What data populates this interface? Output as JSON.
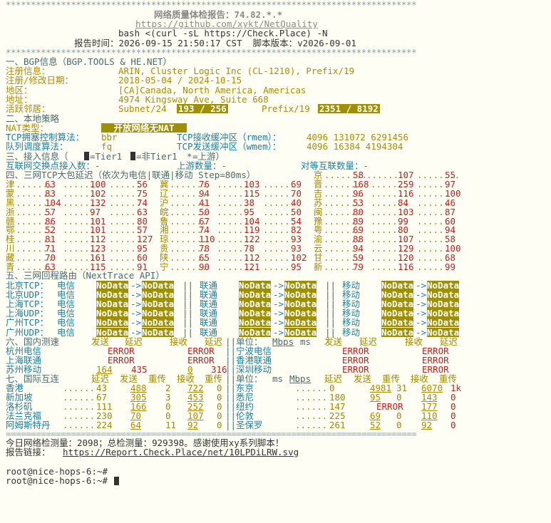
{
  "report": {
    "top_border": "**********************************************************************************",
    "title": "网络质量体检报告：74.82.*.*",
    "url": "https://github.com/xykt/NetQuality",
    "command": "bash <(curl -sL https://Check.Place) -N",
    "time_line": "报告时间：2026-09-15 21:50:17 CST  脚本版本：v2026-09-01",
    "divider": "**********************************************************************************"
  },
  "bgp": {
    "heading": "一、BGP信息（BGP.TOOLS & HE.NET）",
    "rows": [
      {
        "label": "注册信息：",
        "value": "ARIN, Cluster Logic Inc (CL-1210), Prefix/19"
      },
      {
        "label": "注册/修改日期：",
        "value": "2018-05-04 / 2024-10-15"
      },
      {
        "label": "地区：",
        "value": "[CA]Canada, North America, Americas"
      },
      {
        "label": "地址：",
        "value": "4974 Kingsway Ave, Suite 668"
      }
    ],
    "active_label": "活跃邻居：",
    "subnet_label": "Subnet/24",
    "subnet_value": "193 / 256",
    "prefix_label": "Prefix/19",
    "prefix_value": "2351 / 8192"
  },
  "local": {
    "heading": "二、本地策略",
    "nat_label": "NAT类型：",
    "nat_value": "开放网络无NAT",
    "cc_label": "TCP拥塞控制算法：",
    "cc_value": "bbr",
    "rmem_label": "TCP接收缓冲区（rmem）：",
    "rmem_value": "4096 131072 6291456",
    "qd_label": "队列调度算法：",
    "qd_value": "fq",
    "wmem_label": "TCP发送缓冲区（wmem）：",
    "wmem_value": "4096 16384 4194304"
  },
  "access": {
    "heading": "三、接入信息（",
    "legend_a": "=Tier1 ",
    "legend_b": "=非Tier1 ",
    "legend_star": "*",
    "legend_c": "=上游）",
    "ix_label": "互联网交换点接入数：-",
    "up_label": "上游数量：-",
    "peer_label": "对等互联数量：-"
  },
  "tcp": {
    "heading": "四、三网TCP大包延迟（依次为电信|联通|移动 Step=80ms）",
    "rows": [
      {
        "p1": "京",
        "a1": "58",
        "b1": "107",
        "c1": "55"
      },
      {
        "p0": "津",
        "a0": "63",
        "b0": "100",
        "c0": "56",
        "p1": "冀",
        "a1": "76",
        "b1": "103",
        "c1": "69",
        "p2": "晋",
        "a2": "168",
        "b2": "259",
        "c2": "97"
      },
      {
        "p0": "蒙",
        "a0": "83",
        "b0": "102",
        "c0": "75",
        "p1": "辽",
        "a1": "94",
        "b1": "115",
        "c1": "70",
        "p2": "吉",
        "a2": "96",
        "b2": "116",
        "c2": "100"
      },
      {
        "p0": "黑",
        "a0": "104",
        "b0": "132",
        "c0": "74",
        "p1": "沪",
        "a1": "41",
        "b1": "38",
        "c1": "40",
        "p2": "苏",
        "a2": "53",
        "b2": "84",
        "c2": "46"
      },
      {
        "p0": "浙",
        "a0": "57",
        "b0": "97",
        "c0": "63",
        "p1": "皖",
        "a1": "50",
        "b1": "95",
        "c1": "50",
        "p2": "闽",
        "a2": "80",
        "b2": "103",
        "c2": "87"
      },
      {
        "p0": "赣",
        "a0": "86",
        "b0": "101",
        "c0": "80",
        "p1": "鲁",
        "a1": "67",
        "b1": "104",
        "c1": "54",
        "p2": "豫",
        "a2": "89",
        "b2": "99",
        "c2": "60"
      },
      {
        "p0": "鄂",
        "a0": "52",
        "b0": "101",
        "c0": "57",
        "p1": "湘",
        "a1": "74",
        "b1": "119",
        "c1": "82",
        "p2": "粤",
        "a2": "69",
        "b2": "80",
        "c2": "94"
      },
      {
        "p0": "桂",
        "a0": "81",
        "b0": "112",
        "c0": "127",
        "p1": "琼",
        "a1": "110",
        "b1": "122",
        "c1": "93",
        "p2": "渝",
        "a2": "88",
        "b2": "107",
        "c2": "58"
      },
      {
        "p0": "川",
        "a0": "71",
        "b0": "123",
        "c0": "95",
        "p1": "贵",
        "a1": "78",
        "b1": "78",
        "c1": "93",
        "p2": "云",
        "a2": "94",
        "b2": "129",
        "c2": "100"
      },
      {
        "p0": "藏",
        "a0": "70",
        "b0": "161",
        "c0": "60",
        "p1": "陕",
        "a1": "65",
        "b1": "112",
        "c1": "102",
        "p2": "甘",
        "a2": "59",
        "b2": "120",
        "c2": "68"
      },
      {
        "p0": "青",
        "a0": "63",
        "b0": "115",
        "c0": "91",
        "p1": "宁",
        "a1": "90",
        "b1": "121",
        "c1": "95",
        "p2": "新",
        "a2": "79",
        "b2": "116",
        "c2": "99"
      }
    ]
  },
  "route": {
    "heading": "五、三网回程路由（NextTrace API）",
    "rows": [
      {
        "label": "北京TCP：",
        "c": "电信",
        "u": "联通",
        "m": "移动",
        "n": "NoData"
      },
      {
        "label": "北京UDP：",
        "c": "电信",
        "u": "联通",
        "m": "移动",
        "n": "NoData"
      },
      {
        "label": "上海TCP：",
        "c": "电信",
        "u": "联通",
        "m": "移动",
        "n": "NoData"
      },
      {
        "label": "上海UDP：",
        "c": "电信",
        "u": "联通",
        "m": "移动",
        "n": "NoData"
      },
      {
        "label": "广州TCP：",
        "c": "电信",
        "u": "联通",
        "m": "移动",
        "n": "NoData"
      },
      {
        "label": "广州UDP：",
        "c": "电信",
        "u": "联通",
        "m": "移动",
        "n": "NoData"
      }
    ]
  },
  "domestic": {
    "heading": "六、国内测速",
    "h_send": "发送",
    "h_delay": "延迟",
    "h_recv": "接收",
    "h_delay2": "延迟",
    "unit_label": "||单位：",
    "unit": "Mbps",
    "unit_ms": "ms",
    "h_send2": "发送",
    "h_delay3": "延迟",
    "h_recv2": "接收",
    "h_delay4": "延迟",
    "rows": [
      {
        "name": "杭州电信",
        "v1": "ERROR",
        "v2": "ERROR",
        "name2": "||宁波电信",
        "v3": "ERROR",
        "v4": "ERROR"
      },
      {
        "name": "上海联通",
        "v1": "ERROR",
        "v2": "ERROR",
        "name2": "||香港联通",
        "v3": "ERROR",
        "v4": "ERROR"
      },
      {
        "name": "苏州移动",
        "s1": "164",
        "d1": "435",
        "s2": "0",
        "d2": "316",
        "name2": "||深圳移动",
        "v3": "ERROR",
        "v4": "ERROR"
      }
    ]
  },
  "intl": {
    "heading": "七、国际互连",
    "h_delay": "延迟",
    "h_send": "发送",
    "h_retry": "重传",
    "h_recv": "接收",
    "h_retry2": "重传",
    "unit_label": "||单位：",
    "unit_ms": "ms",
    "unit": "Mbps",
    "h_delay2": "延迟",
    "h_send2": "发送",
    "h_retry3": "重传",
    "h_recv2": "接收",
    "h_retry4": "重传",
    "rows": [
      {
        "name": "香港",
        "lat": "43",
        "send": "488",
        "r1": "2",
        "recv": "722",
        "r2": "0",
        "name2": "||东京",
        "lat2": "0",
        "send2": "4981",
        "r3": "31",
        "recv2": "6070",
        "r4": "1k"
      },
      {
        "name": "新加坡",
        "lat": "67",
        "send": "305",
        "r1": "3",
        "recv": "453",
        "r2": "0",
        "name2": "||悉尼",
        "lat2": "180",
        "send2": "95",
        "r3": "0",
        "recv2": "143",
        "r4": "0"
      },
      {
        "name": "洛杉矶",
        "lat": "111",
        "send": "166",
        "r1": "0",
        "recv": "252",
        "r2": "0",
        "name2": "||纽约",
        "lat2": "147",
        "err": "ERROR",
        "recv2": "177",
        "r4": "0"
      },
      {
        "name": "法兰克福",
        "lat": "230",
        "send": "70",
        "r1": "0",
        "recv": "107",
        "r2": "0",
        "name2": "||伦敦",
        "lat2": "225",
        "send2": "69",
        "r3": "0",
        "recv2": "110",
        "r4": "0"
      },
      {
        "name": "阿姆斯特丹",
        "lat": "224",
        "send": "64",
        "r1": "11",
        "recv": "92",
        "r2": "0",
        "name2": "||圣保罗",
        "lat2": "261",
        "send2": "52",
        "r3": "0",
        "recv2": "92",
        "r4": "0"
      }
    ]
  },
  "footer": {
    "bottom_divider": "==================================================================================",
    "stats": "今日网络检测量：2098；总检测量：929398。感谢使用xy系列脚本！",
    "link_label": "报告链接：",
    "link": "https://Report.Check.Place/net/10LPDiLRW.svg",
    "prompt1": "root@nice-hops-6:~#",
    "prompt2": "root@nice-hops-6:~#"
  }
}
